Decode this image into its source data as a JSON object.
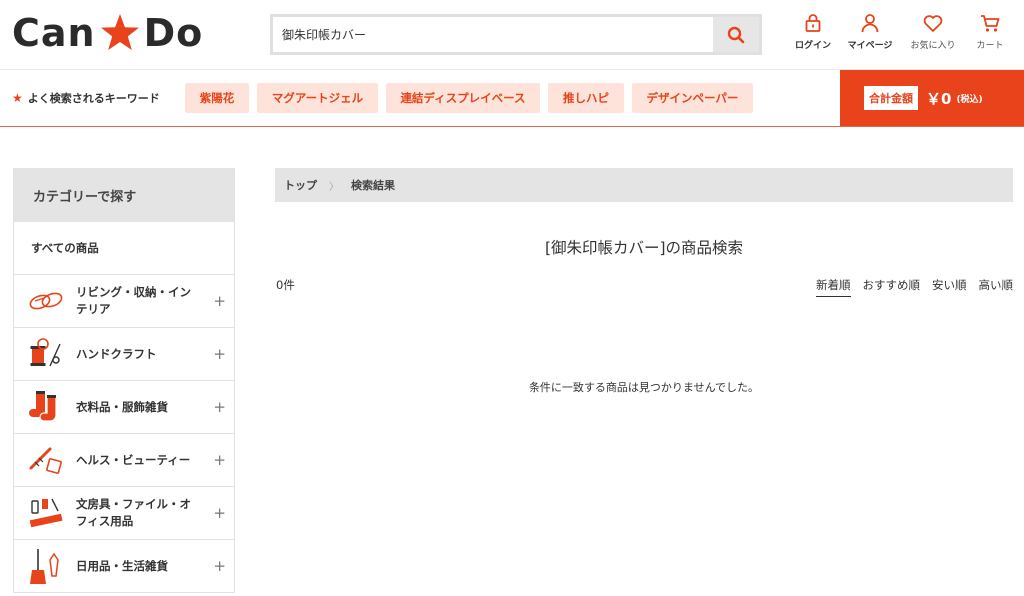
{
  "brand": {
    "logo_left": "Can",
    "logo_right": "Do",
    "accent": "#e8431b"
  },
  "search": {
    "value": "御朱印帳カバー",
    "button_icon": "search-icon"
  },
  "header_links": [
    {
      "label": "ログイン",
      "icon": "lock-icon"
    },
    {
      "label": "マイページ",
      "icon": "user-icon"
    },
    {
      "label": "お気に入り",
      "icon": "heart-icon"
    },
    {
      "label": "カート",
      "icon": "cart-icon"
    }
  ],
  "keywords": {
    "title": "よく検索されるキーワード",
    "items": [
      "紫陽花",
      "マグアートジェル",
      "連結ディスプレイベース",
      "推しハピ",
      "デザインペーパー"
    ]
  },
  "total": {
    "label": "合計金額",
    "amount": "￥0",
    "tax": "(税込)"
  },
  "sidebar": {
    "heading": "カテゴリーで探す",
    "all_label": "すべての商品",
    "items": [
      {
        "label": "リビング・収納・インテリア",
        "icon": "living-icon"
      },
      {
        "label": "ハンドクラフト",
        "icon": "handcraft-icon"
      },
      {
        "label": "衣料品・服飾雑貨",
        "icon": "socks-icon"
      },
      {
        "label": "ヘルス・ビューティー",
        "icon": "beauty-icon"
      },
      {
        "label": "文房具・ファイル・オフィス用品",
        "icon": "stationery-icon"
      },
      {
        "label": "日用品・生活雑貨",
        "icon": "broom-icon"
      }
    ]
  },
  "breadcrumb": {
    "home": "トップ",
    "current": "検索結果"
  },
  "results": {
    "title": "[御朱印帳カバー]の商品検索",
    "count": "0件",
    "sort_options": [
      "新着順",
      "おすすめ順",
      "安い順",
      "高い順"
    ],
    "active_sort": "新着順",
    "empty_message": "条件に一致する商品は見つかりませんでした。"
  }
}
